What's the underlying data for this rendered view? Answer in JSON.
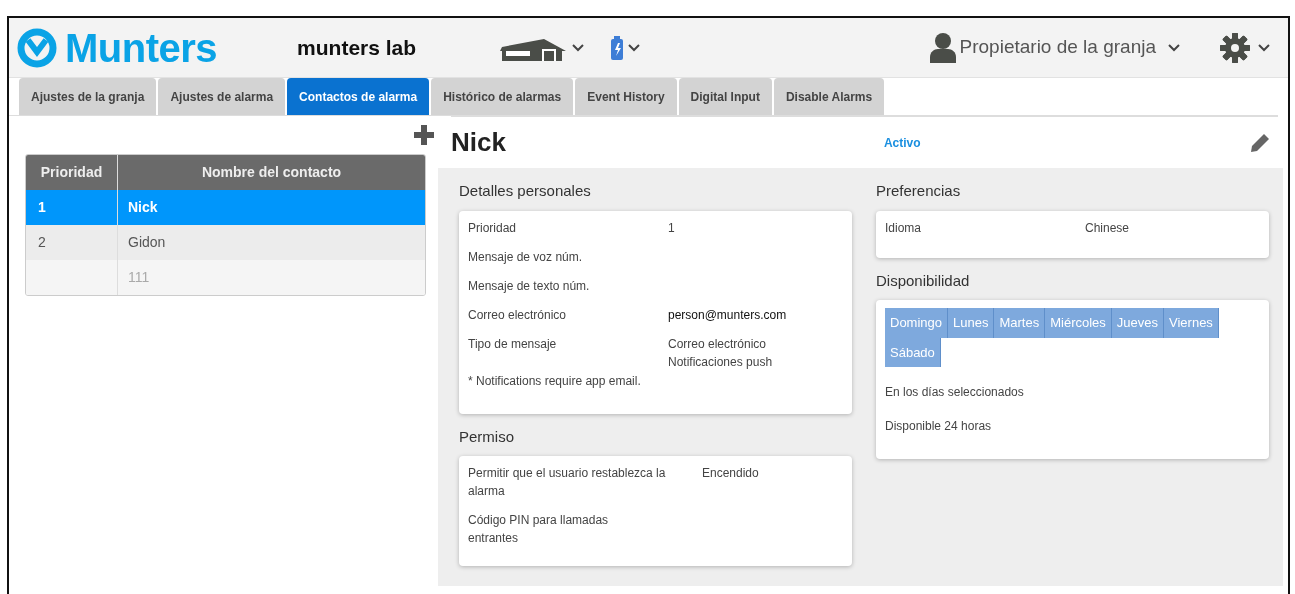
{
  "header": {
    "brand": "Munters",
    "site": "munters lab",
    "user": "Propietario de la granja"
  },
  "tabs": [
    {
      "label": "Ajustes de la granja",
      "selected": false
    },
    {
      "label": "Ajustes de alarma",
      "selected": false
    },
    {
      "label": "Contactos de alarma",
      "selected": true
    },
    {
      "label": "Histórico de alarmas",
      "selected": false
    },
    {
      "label": "Event History",
      "selected": false
    },
    {
      "label": "Digital Input",
      "selected": false
    },
    {
      "label": "Disable Alarms",
      "selected": false
    }
  ],
  "contacts": {
    "columns": [
      "Prioridad",
      "Nombre del contacto"
    ],
    "rows": [
      {
        "priority": "1",
        "name": "Nick",
        "selected": true,
        "disabled": false
      },
      {
        "priority": "2",
        "name": "Gidon",
        "selected": false,
        "disabled": false
      },
      {
        "name": "111",
        "selected": false,
        "disabled": true
      }
    ]
  },
  "detail": {
    "name": "Nick",
    "status": "Activo",
    "personal": {
      "title": "Detalles personales",
      "fields": [
        {
          "label": "Prioridad",
          "value": "1"
        },
        {
          "label": "Mensaje de voz núm."
        },
        {
          "label": "Mensaje de texto núm."
        },
        {
          "label": "Correo electrónico",
          "value": "person@munters.com"
        },
        {
          "label": "Tipo de mensaje",
          "value": "Correo electrónico\nNotificaciones push"
        }
      ],
      "note": "* Notifications require app email."
    },
    "permission": {
      "title": "Permiso",
      "fields": [
        {
          "label": "Permitir que el usuario restablezca la alarma",
          "value": "Encendido"
        },
        {
          "label": "Código PIN para llamadas entrantes"
        }
      ]
    },
    "preferences": {
      "title": "Preferencias",
      "fields": [
        {
          "label": "Idioma",
          "value": "Chinese"
        }
      ]
    },
    "availability": {
      "title": "Disponibilidad",
      "days": [
        {
          "label": "Domingo",
          "selected": true
        },
        {
          "label": "Lunes",
          "selected": true
        },
        {
          "label": "Martes",
          "selected": true
        },
        {
          "label": "Miércoles",
          "selected": true
        },
        {
          "label": "Jueves",
          "selected": true
        },
        {
          "label": "Viernes",
          "selected": true
        },
        {
          "label": "Sábado",
          "selected": true
        }
      ],
      "lines": [
        "En los días seleccionados",
        "Disponible 24 horas"
      ]
    }
  }
}
